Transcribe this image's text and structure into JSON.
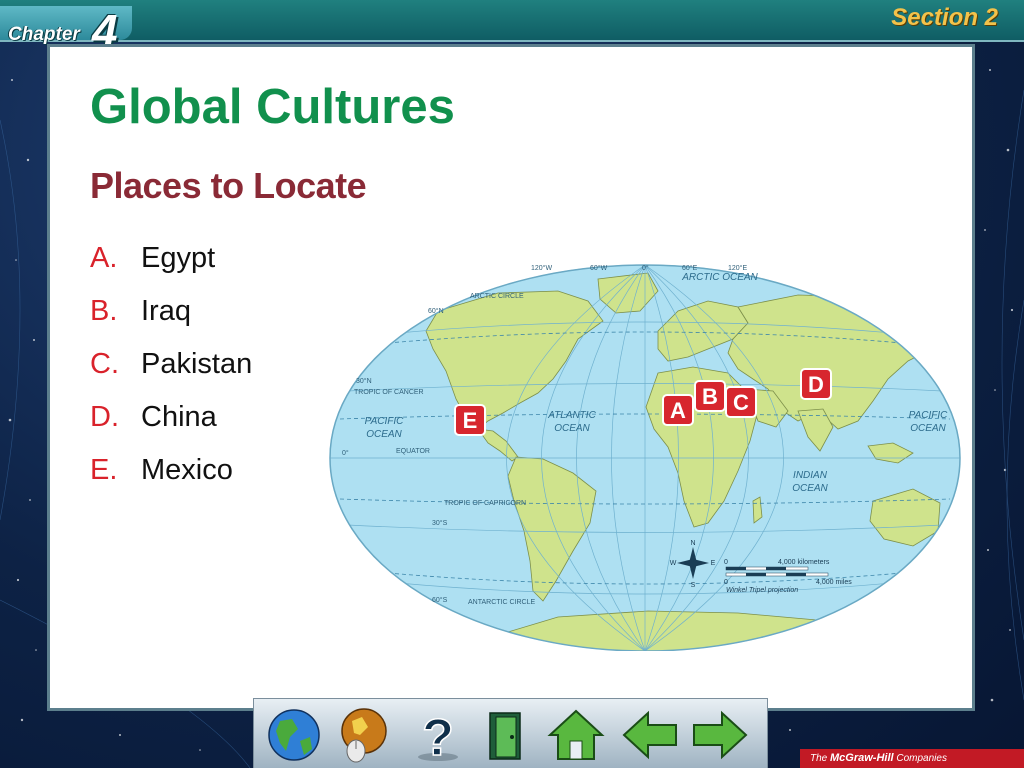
{
  "header": {
    "chapter_label": "Chapter",
    "chapter_number": "4",
    "section_label": "Section 2"
  },
  "slide": {
    "title": "Global Cultures",
    "subtitle": "Places to Locate",
    "items": [
      {
        "letter": "A.",
        "name": "Egypt"
      },
      {
        "letter": "B.",
        "name": "Iraq"
      },
      {
        "letter": "C.",
        "name": "Pakistan"
      },
      {
        "letter": "D.",
        "name": "China"
      },
      {
        "letter": "E.",
        "name": "Mexico"
      }
    ]
  },
  "map": {
    "longitudes": {
      "w120": "120°W",
      "w60": "60°W",
      "zero": "0°",
      "e60": "60°E",
      "e120": "120°E"
    },
    "latitudes": {
      "n60": "60°N",
      "n30": "30°N",
      "equator_deg": "0°",
      "s30": "30°S",
      "s60": "60°S"
    },
    "lines": {
      "arctic_circle": "ARCTIC CIRCLE",
      "tropic_cancer": "TROPIC OF CANCER",
      "equator": "EQUATOR",
      "tropic_capricorn": "TROPIC OF CAPRICORN",
      "antarctic_circle": "ANTARCTIC CIRCLE"
    },
    "oceans": {
      "arctic": "ARCTIC OCEAN",
      "atlantic_1": "ATLANTIC",
      "atlantic_2": "OCEAN",
      "pacific_w_1": "PACIFIC",
      "pacific_w_2": "OCEAN",
      "pacific_e_1": "PACIFIC",
      "pacific_e_2": "OCEAN",
      "indian_1": "INDIAN",
      "indian_2": "OCEAN"
    },
    "markers": {
      "a": "A",
      "b": "B",
      "c": "C",
      "d": "D",
      "e": "E"
    },
    "compass": {
      "n": "N",
      "s": "S",
      "e": "E",
      "w": "W"
    },
    "scale": {
      "zero_km": "0",
      "km": "4,000 kilometers",
      "zero_mi": "0",
      "mi": "4,000 miles",
      "projection": "Winkel Tripel projection"
    }
  },
  "nav": [
    "globe-button",
    "resources-button",
    "help-button",
    "exit-button",
    "home-button",
    "back-button",
    "forward-button"
  ],
  "footer": {
    "publisher_prefix": "The",
    "publisher_name": "McGraw-Hill",
    "publisher_suffix": "Companies"
  },
  "colors": {
    "title_green": "#11904d",
    "subtitle_red": "#8a2a36",
    "letter_red": "#d9222b",
    "ocean": "#aee0f2",
    "land": "#cfe38c",
    "marker_red": "#d7262e",
    "section_gold": "#f3c24a"
  }
}
